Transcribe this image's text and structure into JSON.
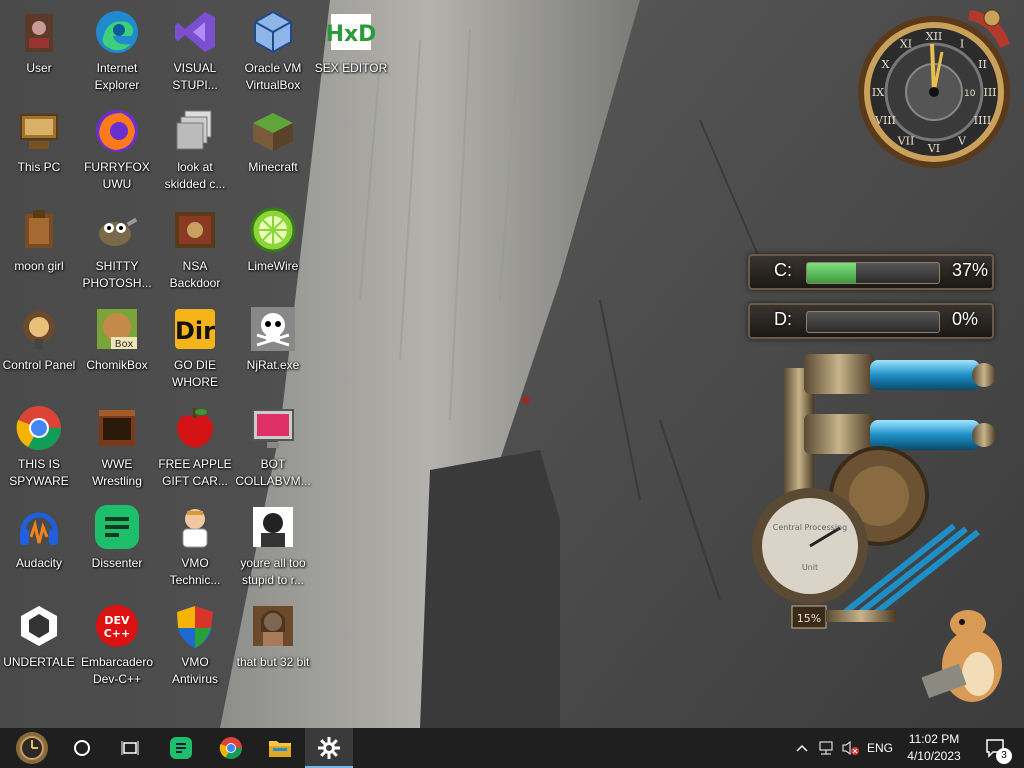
{
  "desktop": {
    "icons": [
      {
        "label": "User",
        "icon": "user-folder-icon"
      },
      {
        "label": "This PC",
        "icon": "computer-icon"
      },
      {
        "label": "moon girl",
        "icon": "moon-girl-icon"
      },
      {
        "label": "Control Panel",
        "icon": "control-panel-icon"
      },
      {
        "label": "THIS IS SPYWARE",
        "icon": "chrome-icon"
      },
      {
        "label": "Audacity",
        "icon": "audacity-icon"
      },
      {
        "label": "UNDERTALE",
        "icon": "unity-icon"
      },
      {
        "label": "Internet Explorer",
        "icon": "edge-icon"
      },
      {
        "label": "FURRYFOX UWU",
        "icon": "firefox-icon"
      },
      {
        "label": "SHITTY PHOTOSH...",
        "icon": "gimp-icon"
      },
      {
        "label": "ChomikBox",
        "icon": "chomikbox-icon"
      },
      {
        "label": "WWE Wrestling",
        "icon": "wwe-icon"
      },
      {
        "label": "Dissenter",
        "icon": "dissenter-icon"
      },
      {
        "label": "Embarcadero Dev-C++",
        "icon": "devcpp-icon"
      },
      {
        "label": "VISUAL STUPI...",
        "icon": "visual-studio-icon"
      },
      {
        "label": "look at skidded c...",
        "icon": "copies-icon"
      },
      {
        "label": "NSA Backdoor",
        "icon": "nsa-backdoor-icon"
      },
      {
        "label": "GO DIE WHORE",
        "icon": "director-icon"
      },
      {
        "label": "FREE APPLE GIFT CAR...",
        "icon": "apple-icon"
      },
      {
        "label": "VMO Technic...",
        "icon": "technician-icon"
      },
      {
        "label": "VMO Antivirus",
        "icon": "shield-icon"
      },
      {
        "label": "Oracle VM VirtualBox",
        "icon": "virtualbox-icon"
      },
      {
        "label": "Minecraft",
        "icon": "minecraft-icon"
      },
      {
        "label": "LimeWire",
        "icon": "limewire-icon"
      },
      {
        "label": "NjRat.exe",
        "icon": "skull-icon"
      },
      {
        "label": "BOT COLLABVM...",
        "icon": "monitor-icon"
      },
      {
        "label": "youre all too stupid to r...",
        "icon": "portrait-icon"
      },
      {
        "label": "that but 32 bit",
        "icon": "portrait-lady-icon"
      },
      {
        "label": "SEX EDITOR",
        "icon": "hxd-icon"
      }
    ]
  },
  "widgets": {
    "clock": {
      "numerals": [
        "XII",
        "I",
        "II",
        "III",
        "IIII",
        "V",
        "VI",
        "VII",
        "VIII",
        "IX",
        "X",
        "XI"
      ],
      "date_day": "10"
    },
    "drives": [
      {
        "letter": "C:",
        "percent_label": "37%",
        "used_fraction": 0.37
      },
      {
        "letter": "D:",
        "percent_label": "0%",
        "used_fraction": 0.0
      }
    ],
    "cpu_gauge": {
      "label": "15%",
      "top_text": "Central Processing",
      "bottom_text": "Unit"
    }
  },
  "taskbar": {
    "start_icon": "steampunk-start-icon",
    "items": [
      {
        "name": "cortana-icon",
        "active": false
      },
      {
        "name": "task-view-icon",
        "active": false
      },
      {
        "name": "dissenter-taskbar-icon",
        "active": false
      },
      {
        "name": "chrome-taskbar-icon",
        "active": false
      },
      {
        "name": "file-explorer-icon",
        "active": false
      },
      {
        "name": "settings-icon",
        "active": true
      }
    ],
    "tray": {
      "language": "ENG",
      "time": "11:02 PM",
      "date": "4/10/2023",
      "notification_count": "3"
    }
  },
  "colors": {
    "taskbar": "#1f1f1f",
    "accent": "#76b9ed",
    "drive_fill": "#4caf50"
  }
}
